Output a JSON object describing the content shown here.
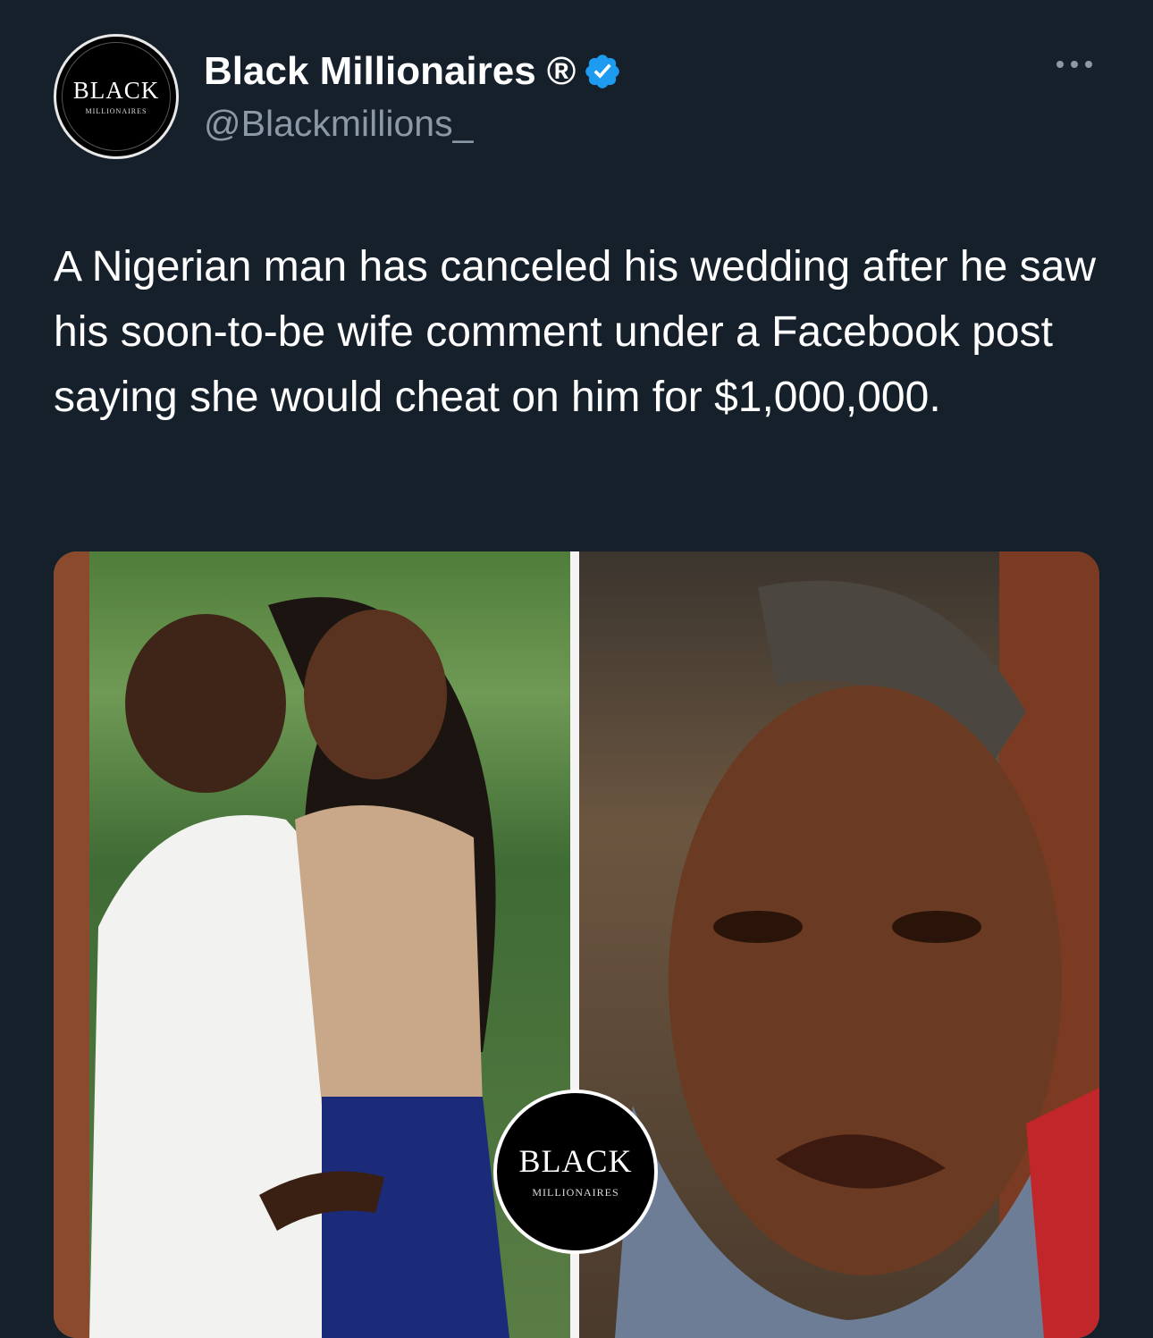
{
  "account": {
    "display_name": "Black Millionaires ®",
    "handle": "@Blackmillions_",
    "verified": true,
    "avatar_logo_word": "BLACK",
    "avatar_logo_sub": "MILLIONAIRES"
  },
  "tweet": {
    "text": "A Nigerian man has canceled his wedding after he saw his soon-to-be wife comment under a Facebook post saying she would cheat on him for $1,000,000."
  },
  "media": {
    "watermark_word": "BLACK",
    "watermark_sub": "MILLIONAIRES"
  },
  "colors": {
    "background": "#15202b",
    "text_primary": "#ffffff",
    "text_secondary": "#8b98a5",
    "verified_badge": "#1d9bf0"
  },
  "icons": {
    "verified": "verified-badge-icon",
    "more": "more-options-icon"
  }
}
